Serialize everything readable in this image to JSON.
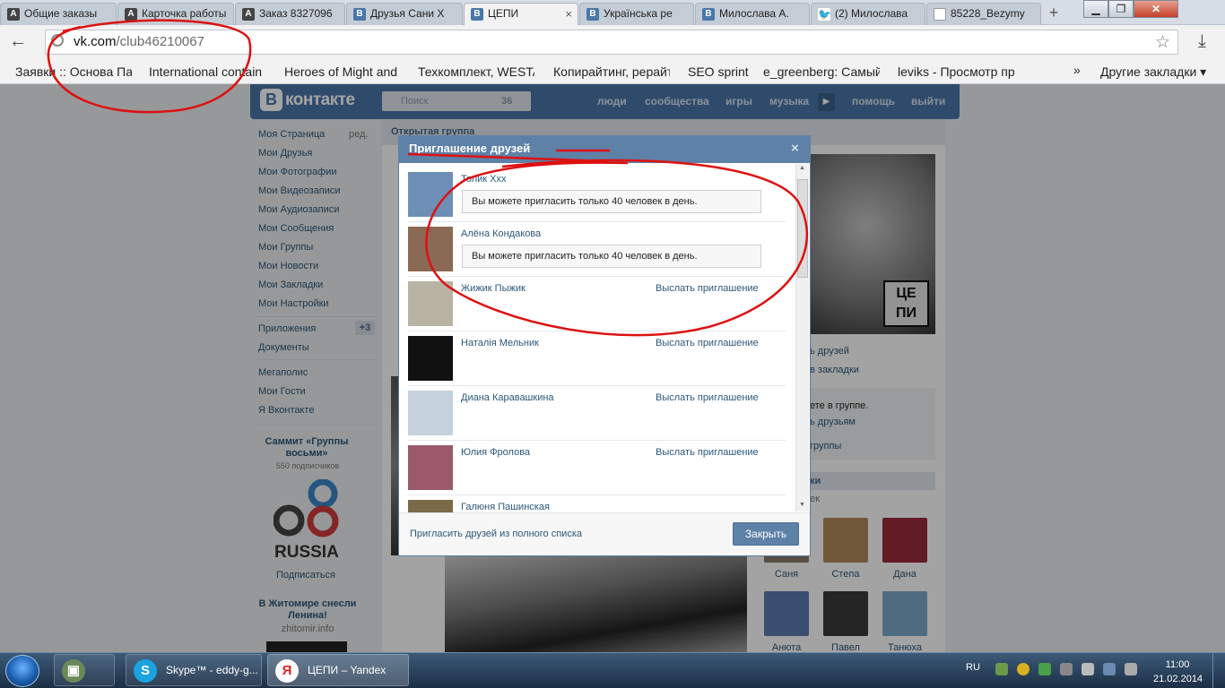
{
  "browser": {
    "tabs": [
      {
        "title": "Общие заказы",
        "icon": "a-icon",
        "active": false
      },
      {
        "title": "Карточка работы",
        "icon": "a-icon",
        "active": false
      },
      {
        "title": "Заказ 8327096",
        "icon": "a-icon",
        "active": false
      },
      {
        "title": "Друзья Сани Х",
        "icon": "vk-icon",
        "active": false
      },
      {
        "title": "ЦЕПИ",
        "icon": "vk-icon",
        "active": true
      },
      {
        "title": "Українська ре",
        "icon": "vk-icon",
        "active": false
      },
      {
        "title": "Милослава А.",
        "icon": "vk-icon",
        "active": false
      },
      {
        "title": "(2) Милослава",
        "icon": "twitter-icon",
        "active": false
      },
      {
        "title": "85228_Bezymy",
        "icon": "document-icon",
        "active": false
      }
    ],
    "new_tab": "+",
    "address": {
      "domain": "vk.com",
      "path": "/club46210067"
    },
    "bookmarks": [
      "Заявки :: Основа Пар",
      "International contain",
      "Heroes of Might and",
      "Техкомплект, WESTA",
      "Копирайтинг, рерайт",
      "SEO sprint",
      "e_greenberg: Самый",
      "leviks - Просмотр пр"
    ],
    "more_bookmarks": "»",
    "other_bookmarks": "Другие закладки ▾"
  },
  "vk": {
    "logo_letter": "В",
    "logo_text": "контакте",
    "search_placeholder": "Поиск",
    "search_count": "36",
    "nav": [
      "люди",
      "сообщества",
      "игры",
      "музыка",
      "помощь",
      "выйти"
    ],
    "left_menu": [
      "Моя Страница",
      "Мои Друзья",
      "Мои Фотографии",
      "Мои Видеозаписи",
      "Мои Аудиозаписи",
      "Мои Сообщения",
      "Мои Группы",
      "Мои Новости",
      "Мои Закладки",
      "Мои Настройки"
    ],
    "edit_label": "ред.",
    "apps_menu": [
      "Приложения",
      "Документы"
    ],
    "apps_badge": "+3",
    "extra_menu": [
      "Мегаполис",
      "Мои Гости",
      "Я Вконтакте"
    ],
    "ad1": {
      "title": "Саммит «Группы восьми»",
      "subs": "550 подписчиков",
      "logo_text": "RUSSIA",
      "subscribe": "Подписаться"
    },
    "ad2": {
      "title": "В Житомире снесли Ленина!",
      "site": "zhitomir.info"
    },
    "group_type": "Открытая группа",
    "poster_text": "ЦЕ ПИ",
    "right_links": [
      "ь друзей",
      "в закладки"
    ],
    "member_text": "ете в группе.",
    "member_friends": "ь друзьям",
    "member_leave": "группы",
    "friends": [
      {
        "name": "Саня",
        "color": "#8a7a6a"
      },
      {
        "name": "Степа",
        "color": "#b28a5c"
      },
      {
        "name": "Дана",
        "color": "#9a2a3a"
      },
      {
        "name": "Анюта",
        "color": "#5a7ab0"
      },
      {
        "name": "Павел",
        "color": "#3a3a3a"
      },
      {
        "name": "Танюха",
        "color": "#7aa8c8"
      }
    ],
    "contacts_label": "ки",
    "contacts_sub": "ек"
  },
  "modal": {
    "title": "Приглашение друзей",
    "close": "×",
    "rows": [
      {
        "name": "Толик Xxx",
        "limit_msg": "Вы можете пригласить только 40 человек в день.",
        "action": "",
        "color": "#6d8fb5"
      },
      {
        "name": "Алёна Кондакова",
        "limit_msg": "Вы можете пригласить только 40 человек в день.",
        "action": "",
        "color": "#8a6a55"
      },
      {
        "name": "Жижик Пыжик",
        "limit_msg": "",
        "action": "Выслать приглашение",
        "color": "#b9b3a3"
      },
      {
        "name": "Наталія Мельник",
        "limit_msg": "",
        "action": "Выслать приглашение",
        "color": "#111111"
      },
      {
        "name": "Диана Каравашкина",
        "limit_msg": "",
        "action": "Выслать приглашение",
        "color": "#c6d3df"
      },
      {
        "name": "Юлия Фролова",
        "limit_msg": "",
        "action": "Выслать приглашение",
        "color": "#9a5a6a"
      },
      {
        "name": "Галюня Пашинская",
        "limit_msg": "",
        "action": "Выслать приглашение",
        "color": "#7a6a4a"
      }
    ],
    "invite_full": "Пригласить друзей из полного списка",
    "close_button": "Закрыть"
  },
  "taskbar": {
    "apps": [
      {
        "label": "",
        "icon": "computer-icon"
      },
      {
        "label": "Skype™ - eddy-g...",
        "icon": "skype-icon"
      },
      {
        "label": "ЦЕПИ – Yandex",
        "icon": "yandex-icon"
      }
    ],
    "lang": "RU",
    "time": "11:00",
    "date": "21.02.2014"
  }
}
